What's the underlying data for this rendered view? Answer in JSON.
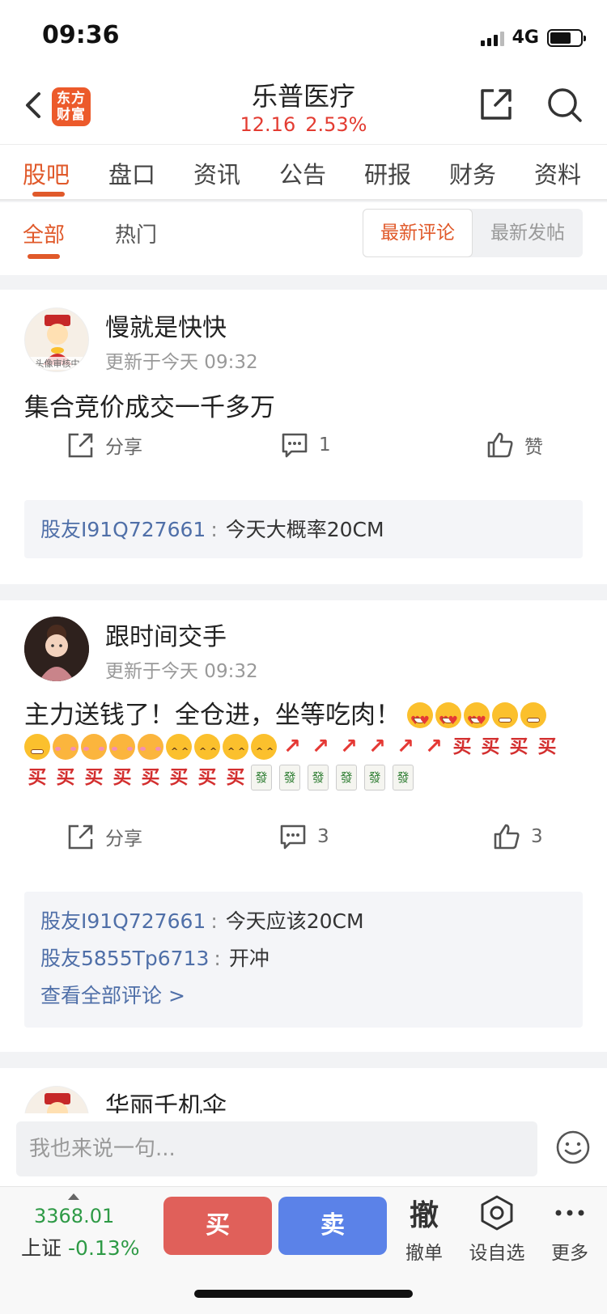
{
  "status": {
    "time": "09:36",
    "network": "4G"
  },
  "header": {
    "logo_line1": "东方",
    "logo_line2": "财富",
    "stock_name": "乐普医疗",
    "price": "12.16",
    "change_pct": "2.53%",
    "price_color": "#e33c32"
  },
  "tabs": [
    "股吧",
    "盘口",
    "资讯",
    "公告",
    "研报",
    "财务",
    "资料"
  ],
  "active_tab": "股吧",
  "subtabs": {
    "all": "全部",
    "hot": "热门",
    "sort_latest_comment": "最新评论",
    "sort_latest_post": "最新发帖"
  },
  "posts": [
    {
      "username": "慢就是快快",
      "updated": "更新于今天 09:32",
      "avatar_badge": "头像审核中",
      "text": "集合竞价成交一千多万",
      "share_label": "分享",
      "comment_count": "1",
      "like_label": "赞",
      "comments": [
        {
          "user": "股友I91Q727661",
          "sep": ":",
          "text": "今天大概率20CM"
        }
      ]
    },
    {
      "username": "跟时间交手",
      "updated": "更新于今天 09:32",
      "text": "主力送钱了！全仓进，坐等吃肉！",
      "emoji_buy": "买",
      "emoji_fa": "發",
      "share_label": "分享",
      "comment_count": "3",
      "like_count": "3",
      "comments": [
        {
          "user": "股友I91Q727661",
          "sep": ":",
          "text": "今天应该20CM"
        },
        {
          "user": "股友5855Tp6713",
          "sep": ":",
          "text": "开冲"
        }
      ],
      "view_all": "查看全部评论 >"
    },
    {
      "username": "华丽千机伞"
    }
  ],
  "input": {
    "placeholder": "我也来说一句..."
  },
  "bottom": {
    "index_value": "3368.01",
    "index_name": "上证",
    "index_change": "-0.13%",
    "index_color": "#2e9a46",
    "buy": "买",
    "sell": "卖",
    "cancel_icon_char": "撤",
    "cancel": "撤单",
    "watchlist": "设自选",
    "more": "更多"
  }
}
